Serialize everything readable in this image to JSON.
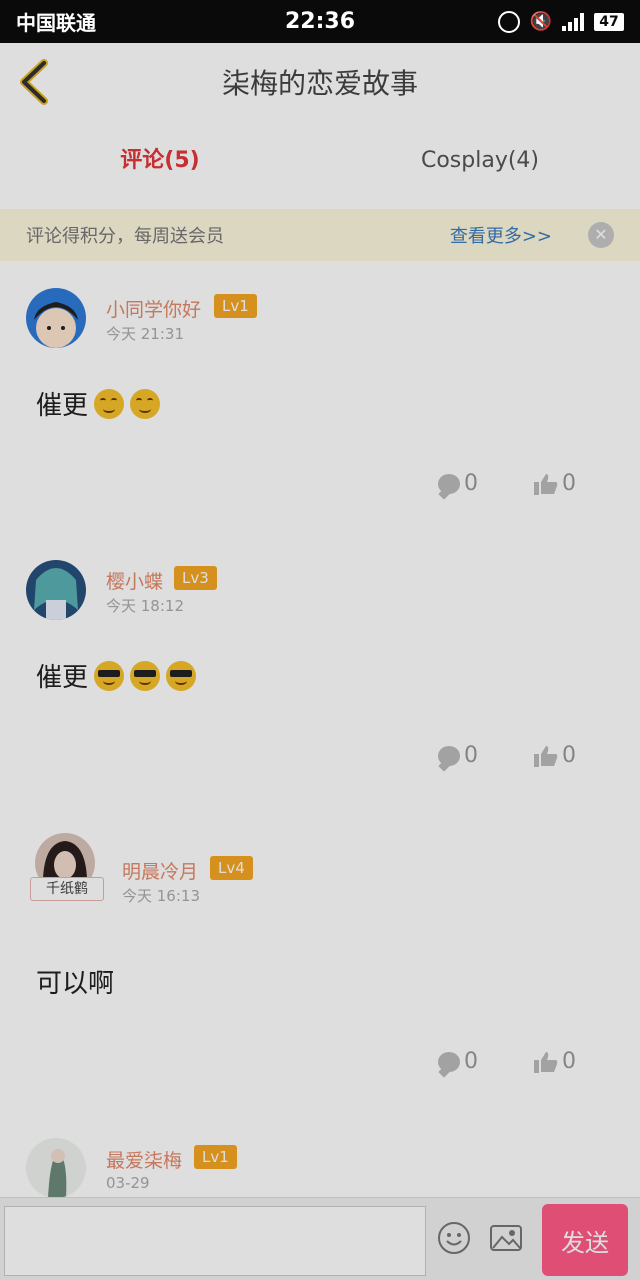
{
  "status_bar": {
    "carrier": "中国联通",
    "time": "22:36",
    "battery": "47"
  },
  "header": {
    "title": "柒梅的恋爱故事"
  },
  "tabs": {
    "comments": "评论(5)",
    "cosplay": "Cosplay(4)"
  },
  "notice": {
    "text": "评论得积分，每周送会员",
    "more": "查看更多>>"
  },
  "comments": [
    {
      "user": "小同学你好",
      "level": "Lv1",
      "time": "今天 21:31",
      "text": "催更",
      "replies": "0",
      "likes": "0"
    },
    {
      "user": "樱小蝶",
      "level": "Lv3",
      "time": "今天 18:12",
      "text": "催更",
      "replies": "0",
      "likes": "0"
    },
    {
      "user": "明晨冷月",
      "level": "Lv4",
      "time": "今天 16:13",
      "text": "可以啊",
      "medal": "千纸鹤",
      "replies": "0",
      "likes": "0"
    },
    {
      "user": "最爱柒梅",
      "level": "Lv1",
      "time": "03-29"
    }
  ],
  "bottom_bar": {
    "send_label": "发送"
  }
}
